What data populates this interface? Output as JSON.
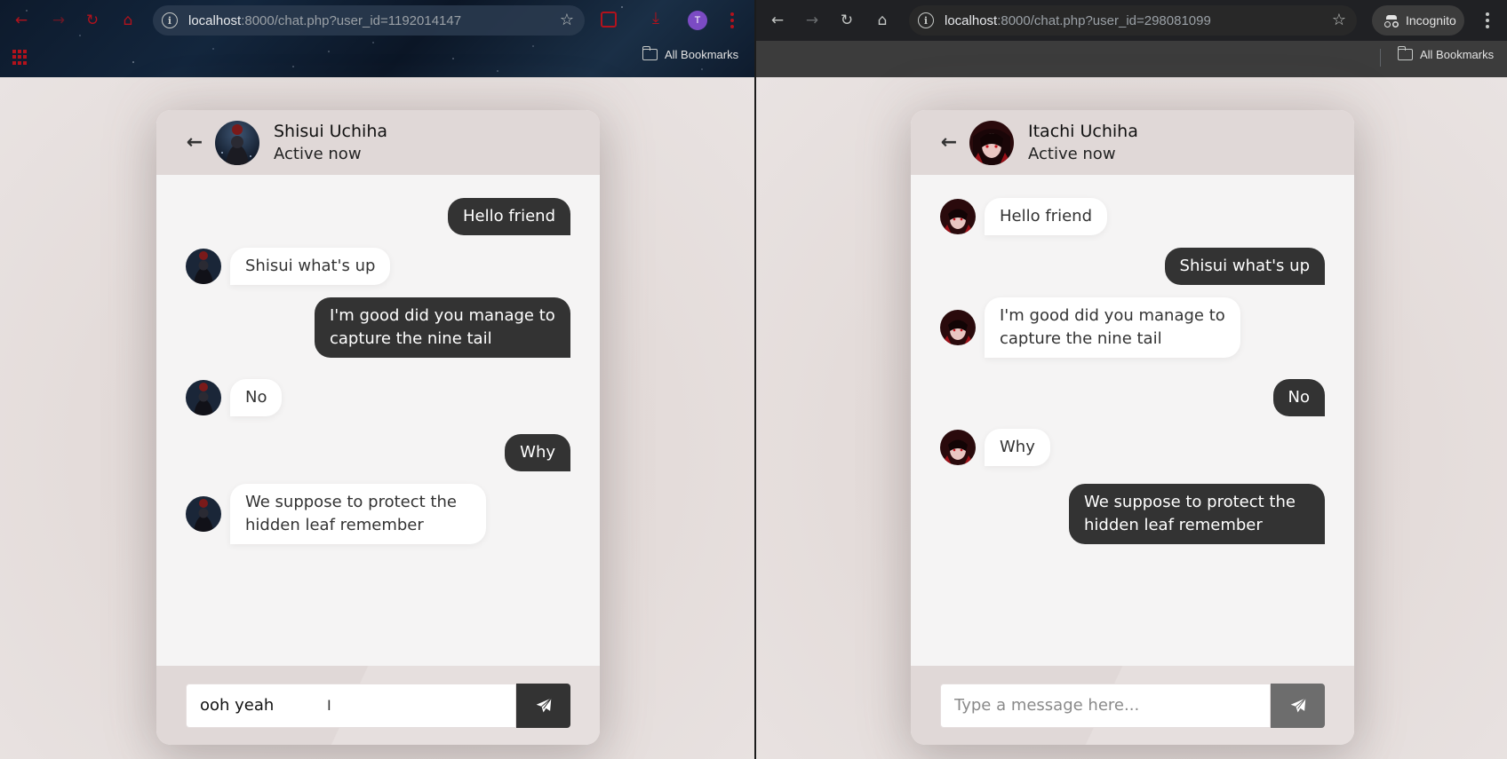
{
  "left_window": {
    "url_host": "localhost",
    "url_rest": ":8000/chat.php?user_id=1192014147",
    "profile_initial": "T",
    "bookmarks_label": "All Bookmarks",
    "chat": {
      "name": "Shisui Uchiha",
      "status": "Active now",
      "messages": [
        {
          "dir": "out",
          "text": "Hello friend"
        },
        {
          "dir": "in",
          "text": "Shisui what's up"
        },
        {
          "dir": "out",
          "text": "I'm good did you manage to capture the nine tail"
        },
        {
          "dir": "in",
          "text": "No"
        },
        {
          "dir": "out",
          "text": "Why"
        },
        {
          "dir": "in",
          "text": "We suppose to protect the hidden leaf remember"
        }
      ],
      "input_value": "ooh yeah",
      "input_placeholder": "Type a message here..."
    }
  },
  "right_window": {
    "url_host": "localhost",
    "url_rest": ":8000/chat.php?user_id=298081099",
    "incognito_label": "Incognito",
    "bookmarks_label": "All Bookmarks",
    "chat": {
      "name": "Itachi Uchiha",
      "status": "Active now",
      "messages": [
        {
          "dir": "in",
          "text": "Hello friend"
        },
        {
          "dir": "out",
          "text": "Shisui what's up"
        },
        {
          "dir": "in",
          "text": "I'm good did you manage to capture the nine tail"
        },
        {
          "dir": "out",
          "text": "No"
        },
        {
          "dir": "in",
          "text": "Why"
        },
        {
          "dir": "out",
          "text": "We suppose to protect the hidden leaf remember"
        }
      ],
      "input_value": "",
      "input_placeholder": "Type a message here..."
    }
  },
  "icons": {
    "back": "arrow-left-icon",
    "send": "paper-plane-icon",
    "star": "star-icon",
    "info": "info-icon"
  },
  "colors": {
    "outgoing_bubble": "#333333",
    "incoming_bubble": "#ffffff",
    "page_background": "#e4dcda",
    "send_button_active": "#333333",
    "send_button_inactive": "#6d6d6d"
  }
}
